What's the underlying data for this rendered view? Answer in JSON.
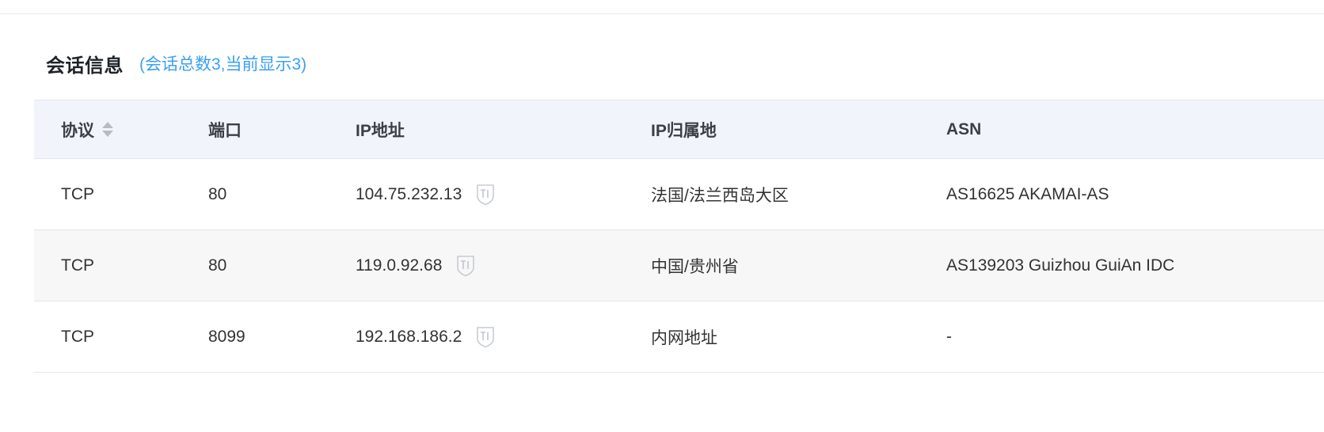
{
  "section": {
    "title": "会话信息",
    "subtitle": "(会话总数3,当前显示3)"
  },
  "table": {
    "columns": {
      "protocol": "协议",
      "port": "端口",
      "ip": "IP地址",
      "geo": "IP归属地",
      "asn": "ASN"
    },
    "rows": [
      {
        "protocol": "TCP",
        "port": "80",
        "ip": "104.75.232.13",
        "geo": "法国/法兰西岛大区",
        "asn": "AS16625 AKAMAI-AS"
      },
      {
        "protocol": "TCP",
        "port": "80",
        "ip": "119.0.92.68",
        "geo": "中国/贵州省",
        "asn": "AS139203 Guizhou GuiAn IDC"
      },
      {
        "protocol": "TCP",
        "port": "8099",
        "ip": "192.168.186.2",
        "geo": "内网地址",
        "asn": "-"
      }
    ]
  },
  "icons": {
    "sort": "sort-icon",
    "threat_intel": "ti-shield-icon"
  },
  "colors": {
    "accent": "#3aa0f3",
    "header_bg": "#f1f5fb",
    "alt_row_bg": "#f7f7f7"
  }
}
